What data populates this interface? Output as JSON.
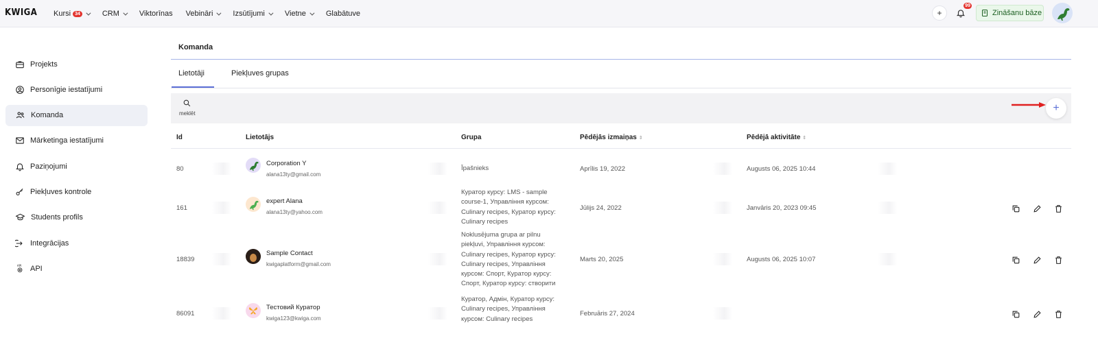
{
  "app": {
    "logo": "KWIGA"
  },
  "nav": {
    "items": [
      {
        "label": "Kursi",
        "badge": "34",
        "dropdown": true
      },
      {
        "label": "CRM",
        "dropdown": true
      },
      {
        "label": "Viktorīnas",
        "dropdown": false
      },
      {
        "label": "Vebināri",
        "dropdown": true
      },
      {
        "label": "Izsūtījumi",
        "dropdown": true
      },
      {
        "label": "Vietne",
        "dropdown": true
      },
      {
        "label": "Glabātuve",
        "dropdown": false
      }
    ],
    "notifications_count": "99",
    "knowledge_base_label": "Zināšanu bāze"
  },
  "sidebar": {
    "items": [
      {
        "label": "Projekts",
        "icon": "briefcase-icon",
        "active": false
      },
      {
        "label": "Personīgie iestatījumi",
        "icon": "user-circle-icon",
        "active": false
      },
      {
        "label": "Komanda",
        "icon": "users-icon",
        "active": true
      },
      {
        "label": "Mārketinga iestatījumi",
        "icon": "mail-icon",
        "active": false
      },
      {
        "label": "Paziņojumi",
        "icon": "bell-icon",
        "active": false
      },
      {
        "label": "Piekļuves kontrole",
        "icon": "key-icon",
        "active": false
      },
      {
        "label": "Students profils",
        "icon": "graduation-cap-icon",
        "active": false
      },
      {
        "label": "Integrācijas",
        "icon": "integration-arrow-icon",
        "active": false
      },
      {
        "label": "API",
        "icon": "api-gear-icon",
        "active": false
      }
    ]
  },
  "main": {
    "title": "Komanda",
    "tabs": [
      {
        "label": "Lietotāji",
        "active": true
      },
      {
        "label": "Piekļuves grupas",
        "active": false
      }
    ],
    "search_label": "meklēt",
    "columns": {
      "id": "Id",
      "user": "Lietotājs",
      "group": "Grupa",
      "last_change": "Pēdējās izmaiņas",
      "last_activity": "Pēdējā aktivitāte"
    },
    "rows": [
      {
        "id": "80",
        "name": "Corporation Y",
        "email": "alana13ty@gmail.com",
        "group": "Īpašnieks",
        "last_change": "Aprīlis 19, 2022",
        "last_activity": "Augusts 06, 2025 10:44",
        "actions": false
      },
      {
        "id": "161",
        "name": "expert Alana",
        "email": "alana13ty@yahoo.com",
        "group": "Куратор курсу: LMS - sample course-1, Управління курсом: Culinary recipes, Куратор курсу: Culinary recipes",
        "last_change": "Jūlijs 24, 2022",
        "last_activity": "Janvāris 20, 2023 09:45",
        "actions": true
      },
      {
        "id": "18839",
        "name": "Sample Contact",
        "email": "kwigaplatform@gmail.com",
        "group": "Noklusējuma grupa ar pilnu piekļuvi, Управління курсом: Culinary recipes, Куратор курсу: Culinary recipes, Управління курсом: Спорт, Куратор курсу: Спорт, Куратор курсу: створити курс на kwiga",
        "last_change": "Marts 20, 2025",
        "last_activity": "Augusts 06, 2025 10:07",
        "actions": true
      },
      {
        "id": "86091",
        "name": "Тестовий Куратор",
        "email": "kwiga123@kwiga.com",
        "group": "Куратор, Адмін, Куратор курсу: Culinary recipes, Управління курсом: Culinary recipes",
        "last_change": "Februāris 27, 2024",
        "last_activity": "",
        "actions": true
      }
    ]
  },
  "colors": {
    "accent": "#5b6fd6",
    "badge": "#e3342f",
    "arrow": "#e02020"
  }
}
